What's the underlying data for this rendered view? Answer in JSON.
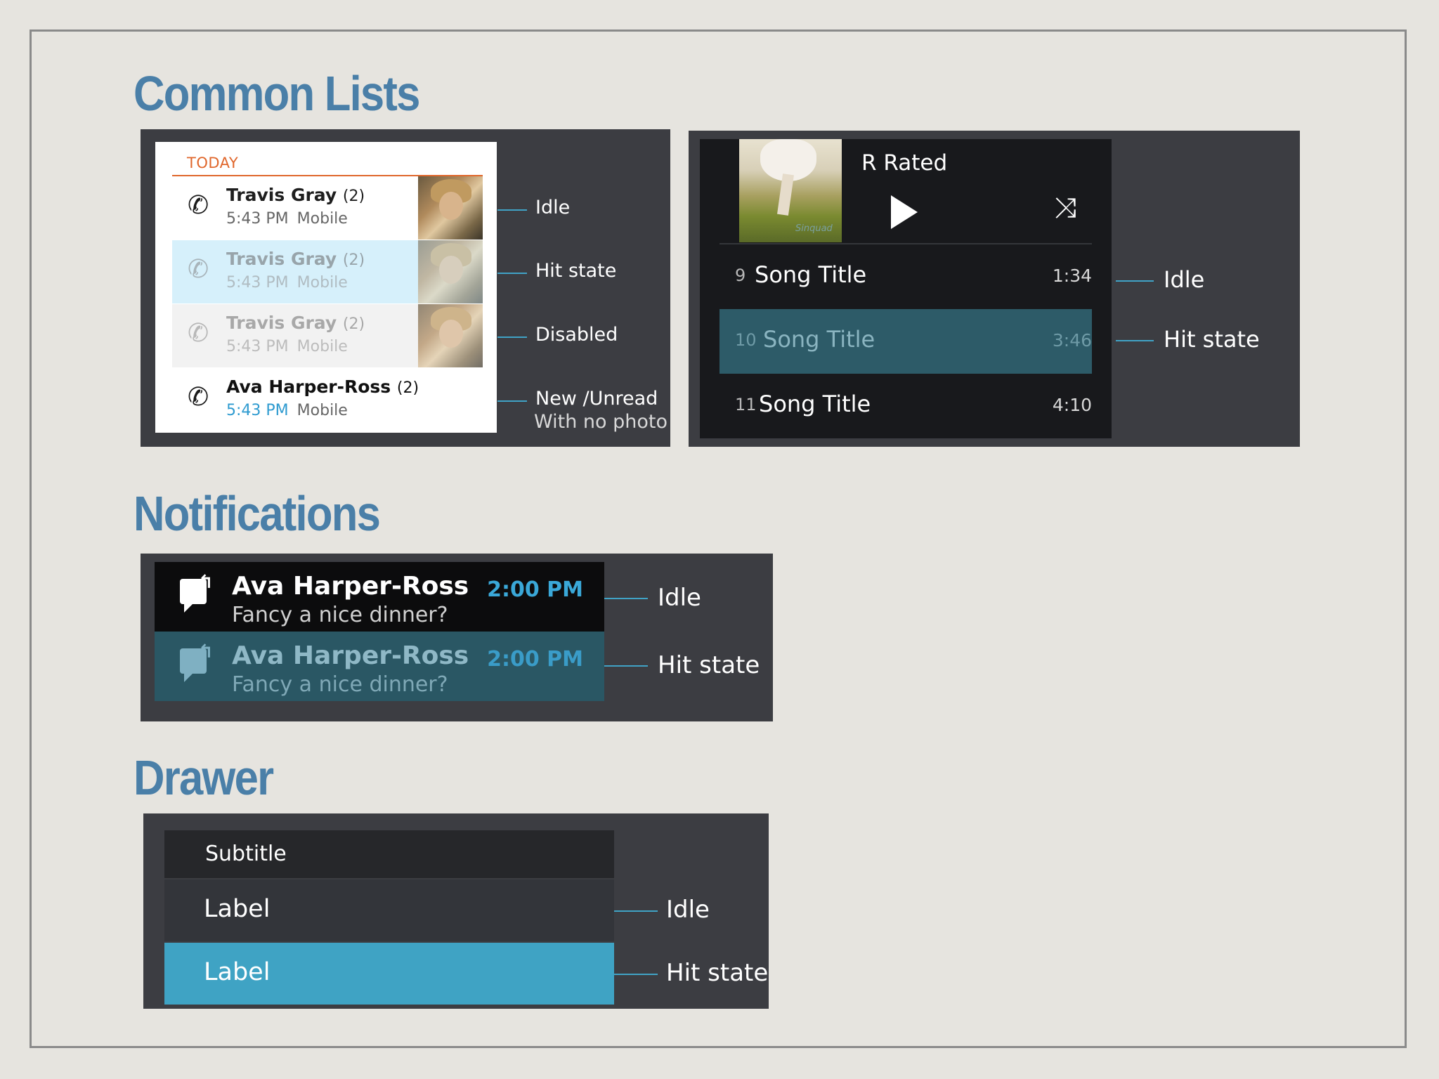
{
  "sections": {
    "lists_title": "Common Lists",
    "notifications_title": "Notifications",
    "drawer_title": "Drawer"
  },
  "call_log": {
    "header": "TODAY",
    "rows": [
      {
        "name": "Travis Gray",
        "count": "(2)",
        "time": "5:43 PM",
        "type": "Mobile",
        "state_label": "Idle"
      },
      {
        "name": "Travis Gray",
        "count": "(2)",
        "time": "5:43 PM",
        "type": "Mobile",
        "state_label": "Hit state"
      },
      {
        "name": "Travis Gray",
        "count": "(2)",
        "time": "5:43 PM",
        "type": "Mobile",
        "state_label": "Disabled"
      },
      {
        "name": "Ava Harper-Ross",
        "count": "(2)",
        "time": "5:43 PM",
        "type": "Mobile",
        "state_label": "New /Unread",
        "state_label2": "With no photo"
      }
    ]
  },
  "music": {
    "album_title": "R Rated",
    "album_brand": "Sinquad",
    "songs": [
      {
        "num": "9",
        "title": "Song Title",
        "duration": "1:34"
      },
      {
        "num": "10",
        "title": "Song Title",
        "duration": "3:46"
      },
      {
        "num": "11",
        "title": "Song Title",
        "duration": "4:10"
      }
    ],
    "state_labels": [
      "Idle",
      "Hit state"
    ]
  },
  "notifications": {
    "items": [
      {
        "name": "Ava Harper-Ross",
        "message": "Fancy a nice dinner?",
        "time": "2:00 PM",
        "state_label": "Idle"
      },
      {
        "name": "Ava Harper-Ross",
        "message": "Fancy a nice dinner?",
        "time": "2:00 PM",
        "state_label": "Hit state"
      }
    ]
  },
  "drawer": {
    "subtitle": "Subtitle",
    "items": [
      {
        "label": "Label",
        "state_label": "Idle"
      },
      {
        "label": "Label",
        "state_label": "Hit state"
      }
    ]
  },
  "colors": {
    "section_title": "#4a7fa8",
    "annotation_line": "#40a3c6",
    "today_orange": "#e0672c",
    "hit_light_blue": "#d6f0fb",
    "hit_teal": "#2d5b68",
    "drawer_hit": "#3fa3c4"
  }
}
